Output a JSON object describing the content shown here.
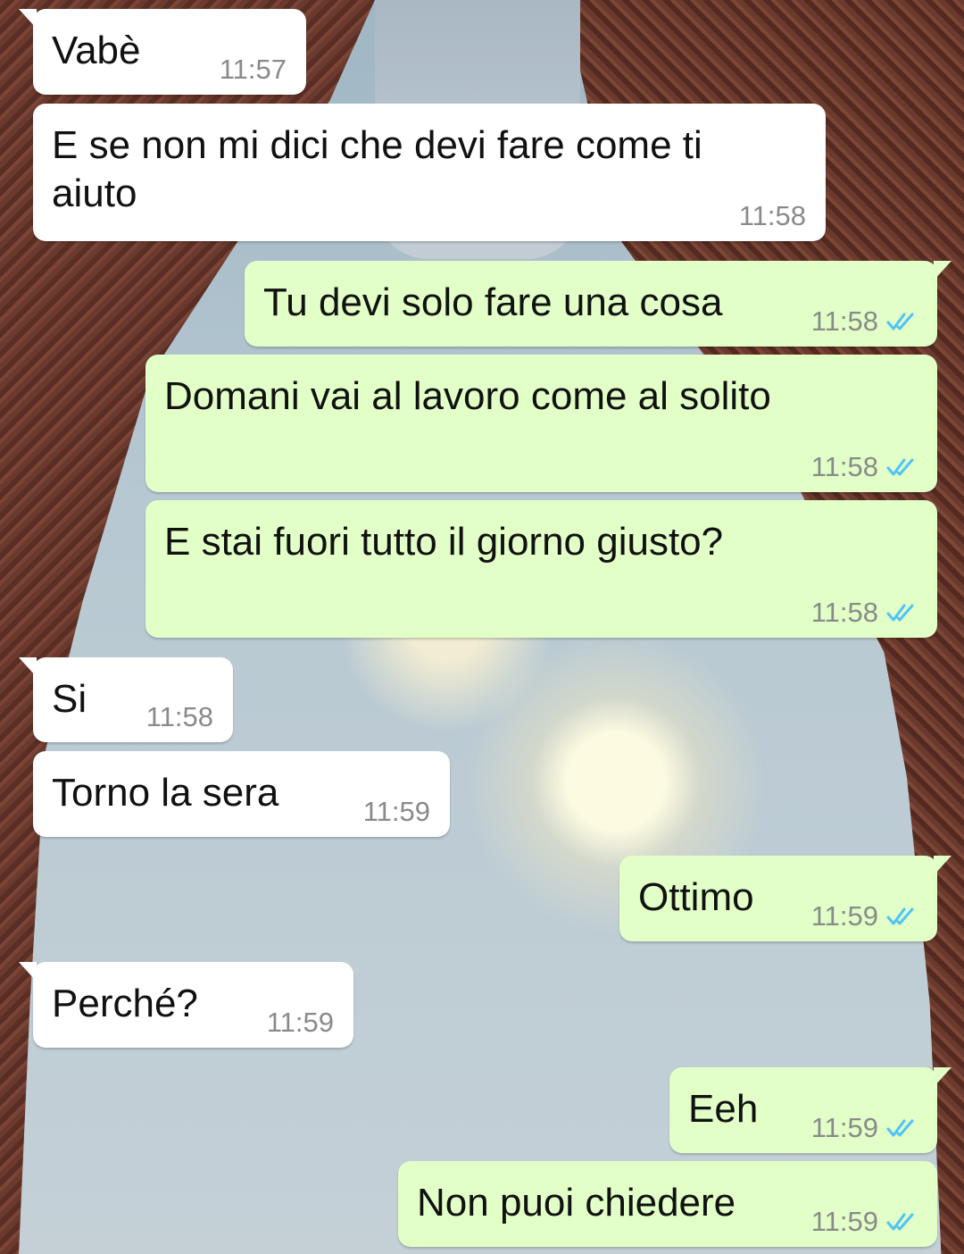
{
  "messages": [
    {
      "text": "Vabè",
      "time": "11:57",
      "direction": "in"
    },
    {
      "text": "E se non mi dici che devi fare come ti aiuto",
      "time": "11:58",
      "direction": "in"
    },
    {
      "text": "Tu devi solo fare una cosa",
      "time": "11:58",
      "direction": "out",
      "status": "read"
    },
    {
      "text": "Domani vai al lavoro come al solito",
      "time": "11:58",
      "direction": "out",
      "status": "read"
    },
    {
      "text": "E stai fuori tutto il giorno giusto?",
      "time": "11:58",
      "direction": "out",
      "status": "read"
    },
    {
      "text": "Si",
      "time": "11:58",
      "direction": "in"
    },
    {
      "text": "Torno la sera",
      "time": "11:59",
      "direction": "in"
    },
    {
      "text": "Ottimo",
      "time": "11:59",
      "direction": "out",
      "status": "read"
    },
    {
      "text": "Perché?",
      "time": "11:59",
      "direction": "in"
    },
    {
      "text": "Eeh",
      "time": "11:59",
      "direction": "out",
      "status": "read"
    },
    {
      "text": "Non puoi chiedere",
      "time": "11:59",
      "direction": "out",
      "status": "read"
    }
  ],
  "colors": {
    "incoming_bubble": "#ffffff",
    "outgoing_bubble": "#e1ffc7",
    "read_ticks": "#4fc3f7",
    "timestamp": "#8a8a8a"
  },
  "icons": {
    "read_receipt": "double-check-icon"
  }
}
